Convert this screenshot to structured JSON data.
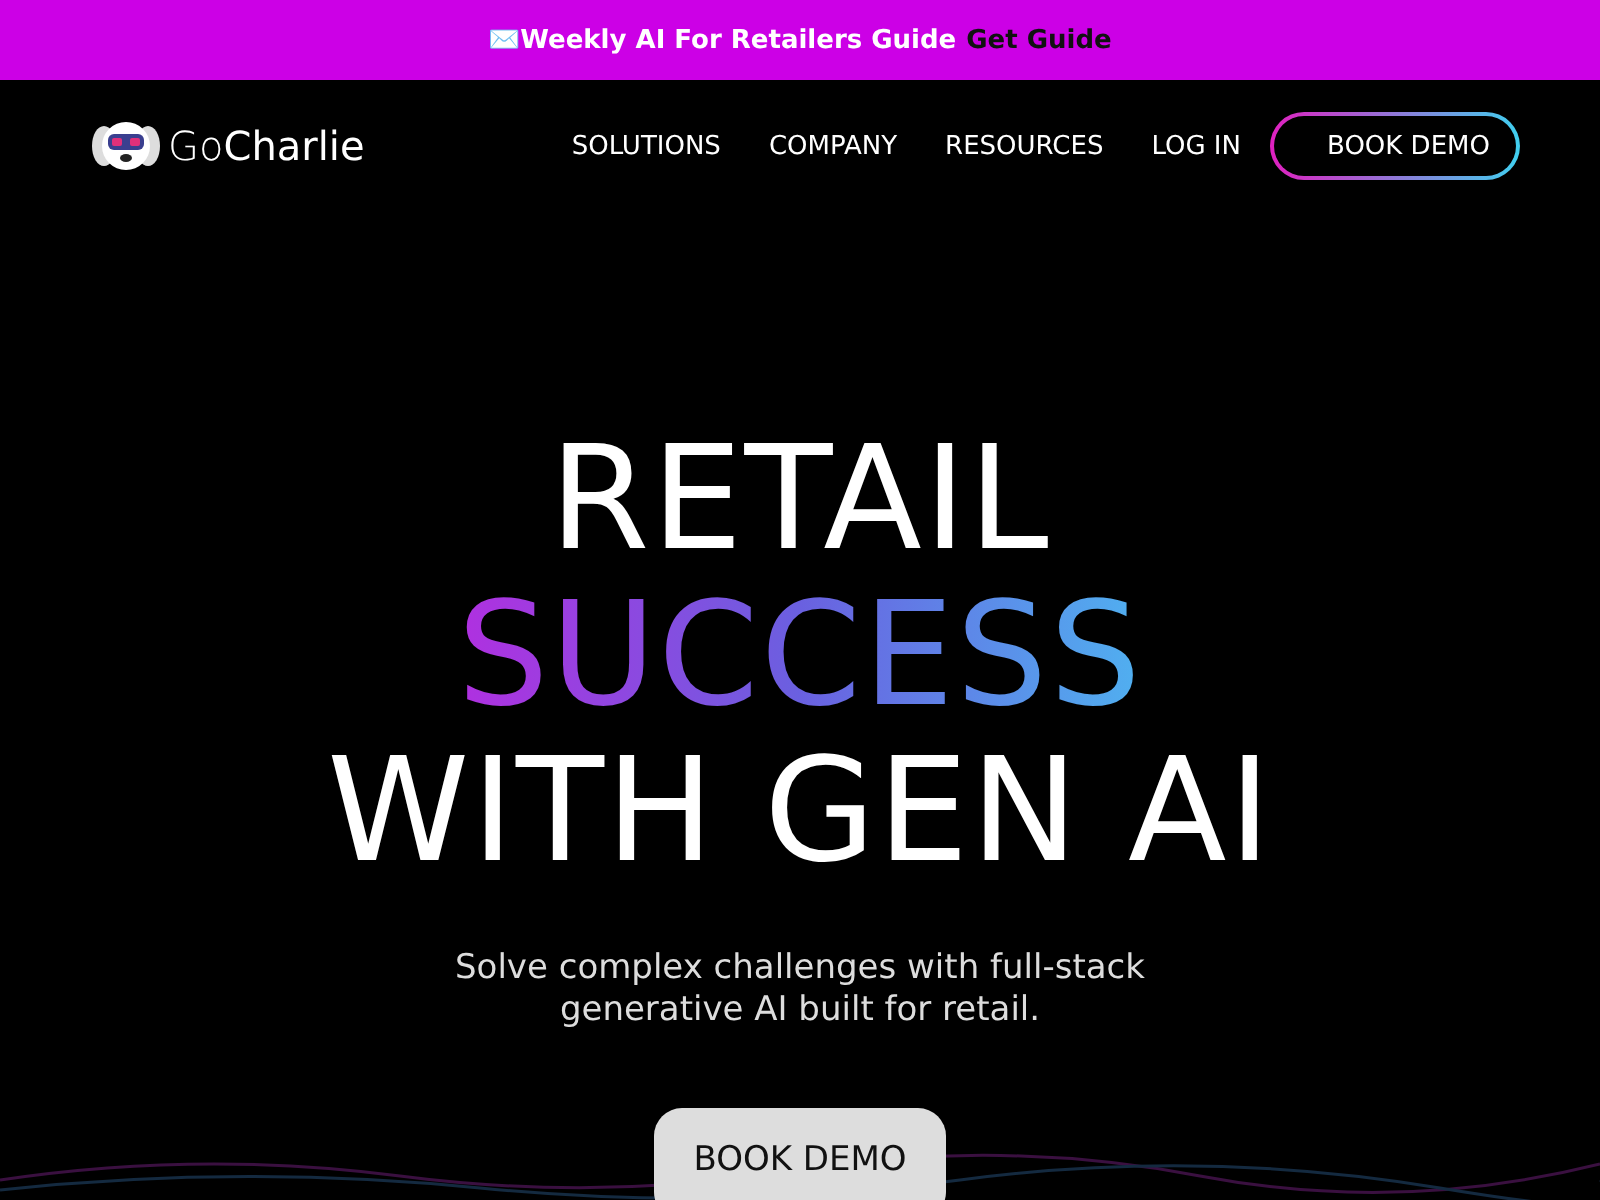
{
  "banner": {
    "icon": "✉️",
    "text": "Weekly AI For Retailers Guide",
    "link": "Get Guide"
  },
  "nav": {
    "logo": "Go**Charlie**",
    "links": [
      "SOLUTIONS",
      "COMPANY",
      "RESOURCES",
      "LOG IN"
    ],
    "cta": "BOOK DEMO"
  },
  "hero": {
    "headline": [
      {
        "text": "RETAIL",
        "kind": "plain"
      },
      {
        "text": "SUCCESS",
        "kind": "gradient"
      },
      {
        "text": "WITH GEN AI",
        "kind": "plain"
      }
    ],
    "subtitle": "Solve complex challenges with full-stack generative AI built for retail.",
    "button": "BOOK DEMO"
  }
}
